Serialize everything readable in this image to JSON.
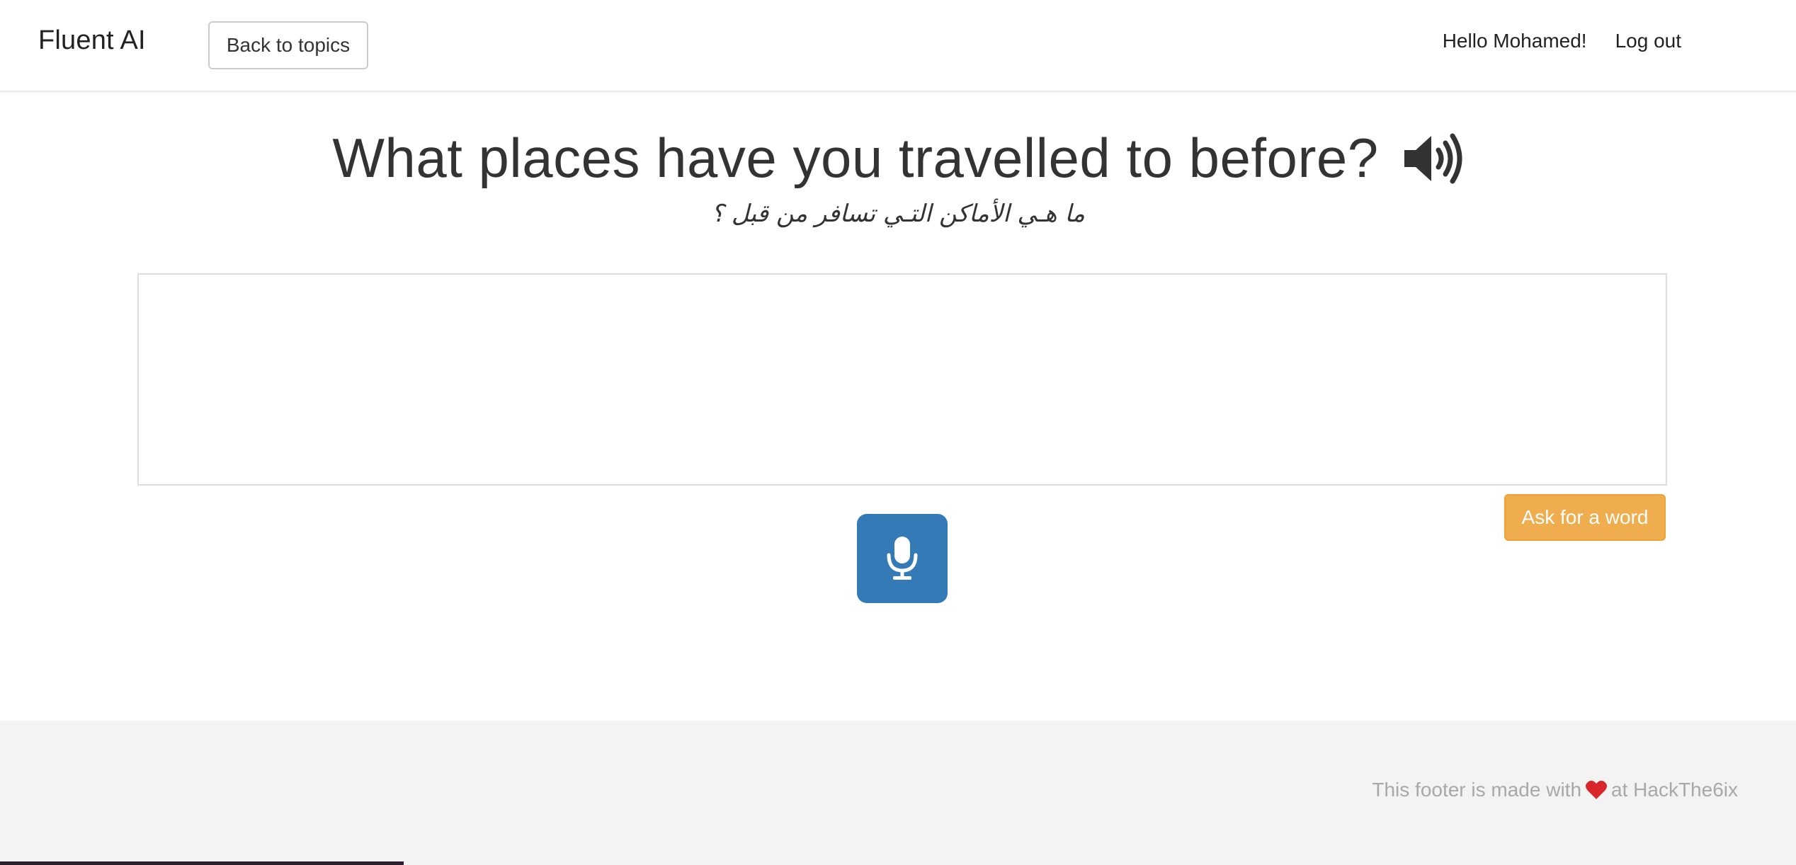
{
  "navbar": {
    "brand": "Fluent AI",
    "back_button": "Back to topics",
    "greeting": "Hello Mohamed!",
    "logout": "Log out"
  },
  "question": {
    "text": "What places have you travelled to before?",
    "translation": "ما هـي الأماكن التـي تسافر من قبل ؟",
    "audio_icon": "speaker-volume-icon"
  },
  "answer": {
    "value": "",
    "placeholder": ""
  },
  "actions": {
    "ask_word": "Ask for a word",
    "mic_icon": "microphone-icon"
  },
  "footer": {
    "prefix": "This footer is made with",
    "suffix": "at HackThe6ix",
    "heart_icon": "heart-icon"
  },
  "colors": {
    "primary": "#337ab7",
    "warning": "#f0ad4e",
    "heart": "#d9262c",
    "footer_bg": "#f3f3f3"
  }
}
